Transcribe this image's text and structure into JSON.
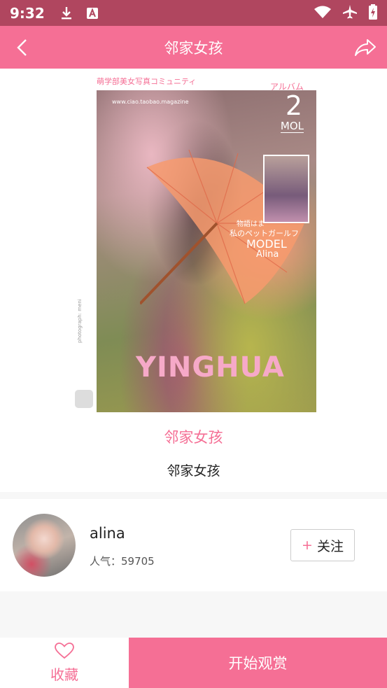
{
  "status_bar": {
    "time": "9:32",
    "icons": [
      "download-icon",
      "a-badge-icon",
      "wifi-icon",
      "airplane-icon",
      "battery-icon"
    ]
  },
  "header": {
    "title": "邻家女孩",
    "back_icon": "chevron-left-icon",
    "share_icon": "share-arrow-icon"
  },
  "cover": {
    "caption_top": "萌学部美女写真コミュニティ",
    "album_label": "アルバム",
    "magazine_url": "www.ciao.taobao.magazine",
    "issue_number": "2",
    "issue_label": "MOL",
    "tagline_1": "物語はま",
    "tagline_2": "私のペットガールフ",
    "model_label": "MODEL",
    "model_name": "Alina",
    "brand": "YINGHUA",
    "side_text": "photograph: meni"
  },
  "album": {
    "title": "邻家女孩",
    "subtitle": "邻家女孩"
  },
  "author": {
    "name": "alina",
    "popularity": "人气：59705",
    "follow_label": "关注"
  },
  "bottom": {
    "favorite_label": "收藏",
    "start_label": "开始观赏"
  },
  "colors": {
    "accent": "#f56f95",
    "status_bar": "#b0465f"
  }
}
